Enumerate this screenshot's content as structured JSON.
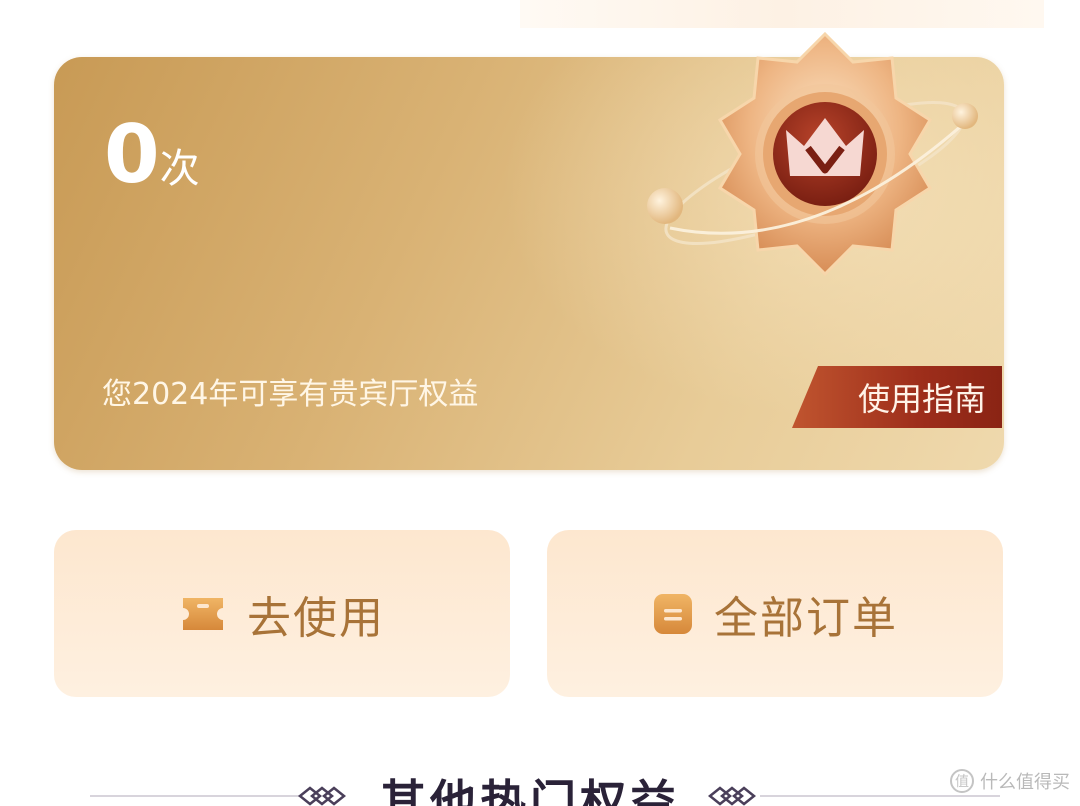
{
  "card": {
    "count_number": "0",
    "count_unit": "次",
    "description": "您2024年可享有贵宾厅权益",
    "guide_label": "使用指南"
  },
  "actions": [
    {
      "label": "去使用",
      "icon": "ticket-icon"
    },
    {
      "label": "全部订单",
      "icon": "order-list-icon"
    }
  ],
  "section": {
    "title": "其他热门权益"
  },
  "watermark": {
    "text": "什么值得买",
    "icon_glyph": "值"
  },
  "colors": {
    "card_gold": "#d9b274",
    "guide_red": "#9e2e1b",
    "action_bg": "#fde7cf",
    "action_text": "#a87338",
    "title_text": "#2a2238"
  }
}
